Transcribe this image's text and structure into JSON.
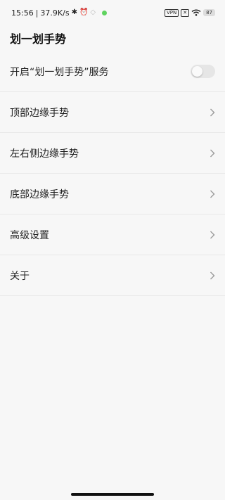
{
  "status_bar": {
    "time": "15:56",
    "speed": "37.9K/s",
    "vpn": "VPN",
    "battery": "87"
  },
  "app_bar": {
    "title": "划一划手势"
  },
  "settings": [
    {
      "label": "开启“划一划手势”服务",
      "control": "toggle",
      "checked": false
    },
    {
      "label": "顶部边缘手势",
      "control": "chevron"
    },
    {
      "label": "左右侧边缘手势",
      "control": "chevron"
    },
    {
      "label": "底部边缘手势",
      "control": "chevron"
    },
    {
      "label": "高级设置",
      "control": "chevron"
    },
    {
      "label": "关于",
      "control": "chevron"
    }
  ],
  "colors": {
    "background": "#f7f7f7",
    "divider": "#e9e9e9",
    "toggle_off": "#e6e6e6",
    "chevron": "#9a9a9a"
  },
  "icons": [
    "alarm-icon",
    "wifi-icon",
    "battery-icon",
    "chevron-right-icon",
    "toggle-switch"
  ]
}
